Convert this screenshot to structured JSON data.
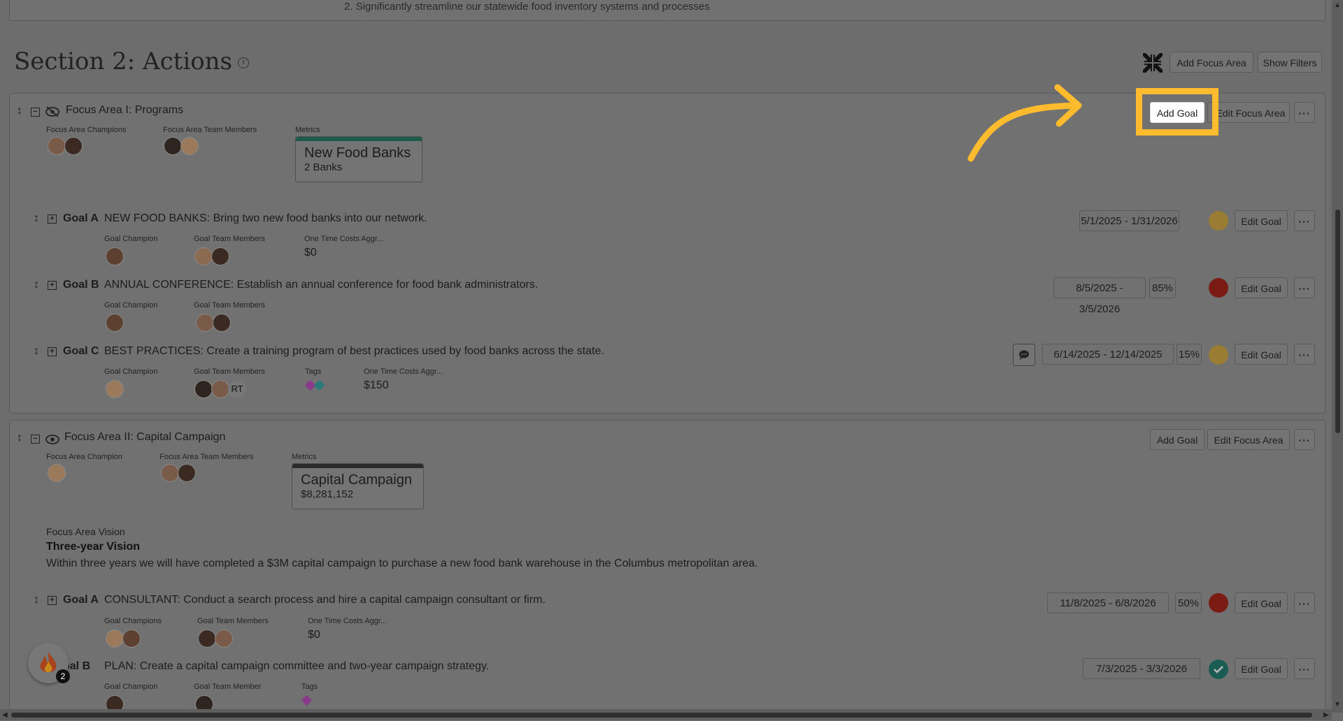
{
  "top_text": "2. Significantly streamline our statewide food inventory systems and processes",
  "section": {
    "title": "Section 2: Actions",
    "info_icon": "info-icon"
  },
  "toolbar": {
    "add_focus_area": "Add Focus Area",
    "show_filters": "Show Filters",
    "collapse_icon": "collapse-arrows-icon"
  },
  "focus_areas": [
    {
      "title": "Focus Area I: Programs",
      "champions_label": "Focus Area Champions",
      "team_label": "Focus Area Team Members",
      "metrics_label": "Metrics",
      "metric": {
        "title": "New Food Banks",
        "value": "2 Banks",
        "bar_color": "#1c5b4a"
      },
      "add_goal": "Add Goal",
      "edit_focus_area": "Edit Focus Area",
      "more": "···",
      "goals": [
        {
          "key": "Goal A",
          "text": "NEW FOOD BANKS: Bring two new food banks into our network.",
          "champ_label": "Goal Champion",
          "team_label": "Goal Team Members",
          "cost_label": "One Time Costs Aggr...",
          "cost": "$0",
          "dates": "5/1/2025 - 1/31/2026",
          "pct": "",
          "status_color": "#9a7c33",
          "edit": "Edit Goal",
          "more": "···"
        },
        {
          "key": "Goal B",
          "text": "ANNUAL CONFERENCE: Establish an annual conference for food bank administrators.",
          "champ_label": "Goal Champion",
          "team_label": "Goal Team Members",
          "dates": "8/5/2025 - 3/5/2026",
          "pct": "85%",
          "status_color": "#7a1c14",
          "edit": "Edit Goal",
          "more": "···"
        },
        {
          "key": "Goal C",
          "text": "BEST PRACTICES: Create a training program of best practices used by food banks across the state.",
          "champ_label": "Goal Champion",
          "team_label": "Goal Team Members",
          "tags_label": "Tags",
          "cost_label": "One Time Costs Aggr...",
          "cost": "$150",
          "dates": "6/14/2025 - 12/14/2025",
          "pct": "15%",
          "status_color": "#9a7c33",
          "edit": "Edit Goal",
          "more": "···",
          "rt": "RT"
        }
      ]
    },
    {
      "title": "Focus Area II: Capital Campaign",
      "champions_label": "Focus Area Champion",
      "team_label": "Focus Area Team Members",
      "metrics_label": "Metrics",
      "metric": {
        "title": "Capital Campaign",
        "value": "$8,281,152",
        "bar_color": "#2a2a2a"
      },
      "add_goal": "Add Goal",
      "edit_focus_area": "Edit Focus Area",
      "more": "···",
      "vision": {
        "label": "Focus Area Vision",
        "title": "Three-year Vision",
        "body": "Within three years we will have completed a $3M capital campaign to purchase a new food bank warehouse in the Columbus metropolitan area."
      },
      "goals": [
        {
          "key": "Goal A",
          "text": "CONSULTANT: Conduct a search process and hire a capital campaign consultant or firm.",
          "champ_label": "Goal Champions",
          "team_label": "Goal Team Members",
          "cost_label": "One Time Costs Aggr...",
          "cost": "$0",
          "dates": "11/8/2025 - 6/8/2026",
          "pct": "50%",
          "status_color": "#7a1c14",
          "edit": "Edit Goal",
          "more": "···"
        },
        {
          "key": "oal B",
          "text": "PLAN: Create a capital campaign committee and two-year campaign strategy.",
          "champ_label": "Goal Champion",
          "team_label": "Goal Team Member",
          "tags_label": "Tags",
          "dates": "7/3/2025 - 3/3/2026",
          "pct": "",
          "status_color": "#1a5b52",
          "edit": "Edit Goal",
          "more": "···"
        }
      ]
    }
  ],
  "fab": {
    "badge": "2"
  }
}
